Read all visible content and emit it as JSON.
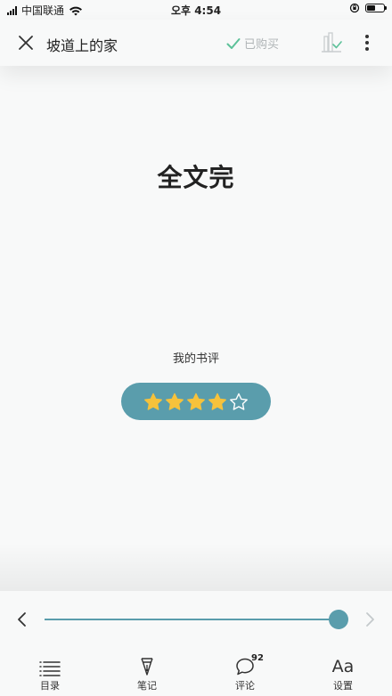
{
  "status_bar": {
    "carrier": "中国联通",
    "time": "오후 4:54",
    "battery_level": 0.5
  },
  "header": {
    "book_title": "坡道上的家",
    "purchased_label": "已购买",
    "close_icon": "close-icon",
    "purchased_icon": "checkmark-icon",
    "bookshelf_icon": "add-to-bookshelf-icon",
    "more_icon": "more-vertical-icon"
  },
  "content": {
    "end_title": "全文完",
    "review_label": "我的书评",
    "rating": {
      "value": 4,
      "max": 5
    }
  },
  "reader_controls": {
    "progress": 1.0,
    "prev_icon": "chevron-left-icon",
    "next_icon": "chevron-right-icon",
    "tabs": [
      {
        "label": "目录",
        "icon": "list-icon"
      },
      {
        "label": "笔记",
        "icon": "pen-nib-icon"
      },
      {
        "label": "评论",
        "icon": "comment-bubble-icon",
        "badge": "92"
      },
      {
        "label": "设置",
        "icon": "font-size-icon",
        "icon_text": "Aa"
      }
    ]
  },
  "colors": {
    "accent": "#5a9dac",
    "star": "#f6c23b",
    "background": "#f8f9f9",
    "purchased_check": "#5cc199"
  }
}
